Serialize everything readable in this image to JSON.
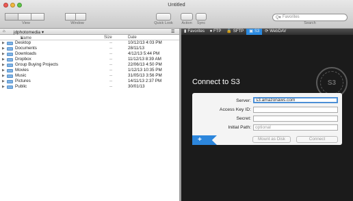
{
  "window": {
    "title": "Untitled"
  },
  "toolbar": {
    "view_label": "View",
    "window_label": "Window",
    "quick_look_label": "Quick Look",
    "action_label": "Action",
    "sync_label": "Sync",
    "search_label": "Search",
    "search_placeholder": "Favorites"
  },
  "left": {
    "path": "jdphotomedia",
    "columns": {
      "name": "Name",
      "size": "Size",
      "date": "Date"
    },
    "items": [
      {
        "name": "Desktop",
        "size": "--",
        "date": "10/12/13 4:03 PM"
      },
      {
        "name": "Documents",
        "size": "--",
        "date": "28/11/13"
      },
      {
        "name": "Downloads",
        "size": "--",
        "date": "4/12/13 5:44 PM"
      },
      {
        "name": "Dropbox",
        "size": "--",
        "date": "11/12/13 8:39 AM"
      },
      {
        "name": "Group Buying Projects",
        "size": "--",
        "date": "22/06/13 4:50 PM"
      },
      {
        "name": "Movies",
        "size": "--",
        "date": "1/12/13 10:35 PM"
      },
      {
        "name": "Music",
        "size": "--",
        "date": "31/05/13 3:56 PM"
      },
      {
        "name": "Pictures",
        "size": "--",
        "date": "14/11/13 2:37 PM"
      },
      {
        "name": "Public",
        "size": "--",
        "date": "30/01/13"
      }
    ]
  },
  "right": {
    "tabs": [
      {
        "label": "Favorites",
        "icon": "book-icon",
        "glyph": "▮"
      },
      {
        "label": "FTP",
        "icon": "globe-icon",
        "glyph": "⏺"
      },
      {
        "label": "SFTP",
        "icon": "lock-icon",
        "glyph": "🔒"
      },
      {
        "label": "S3",
        "icon": "s3-icon",
        "glyph": "▣"
      },
      {
        "label": "WebDAV",
        "icon": "webdav-icon",
        "glyph": "⟳"
      }
    ],
    "active_tab": "S3",
    "connect_title": "Connect to S3",
    "badge_text": "S3",
    "form": {
      "server_label": "Server:",
      "server_value": "s3.amazonaws.com",
      "access_key_label": "Access Key ID:",
      "access_key_value": "",
      "secret_label": "Secret:",
      "secret_value": "",
      "initial_path_label": "Initial Path:",
      "initial_path_placeholder": "optional",
      "mount_label": "Mount as Disk",
      "connect_label": "Connect",
      "add_label": "+"
    }
  },
  "colors": {
    "accent": "#2b8ae0",
    "right_bg": "#1b1b1b"
  }
}
